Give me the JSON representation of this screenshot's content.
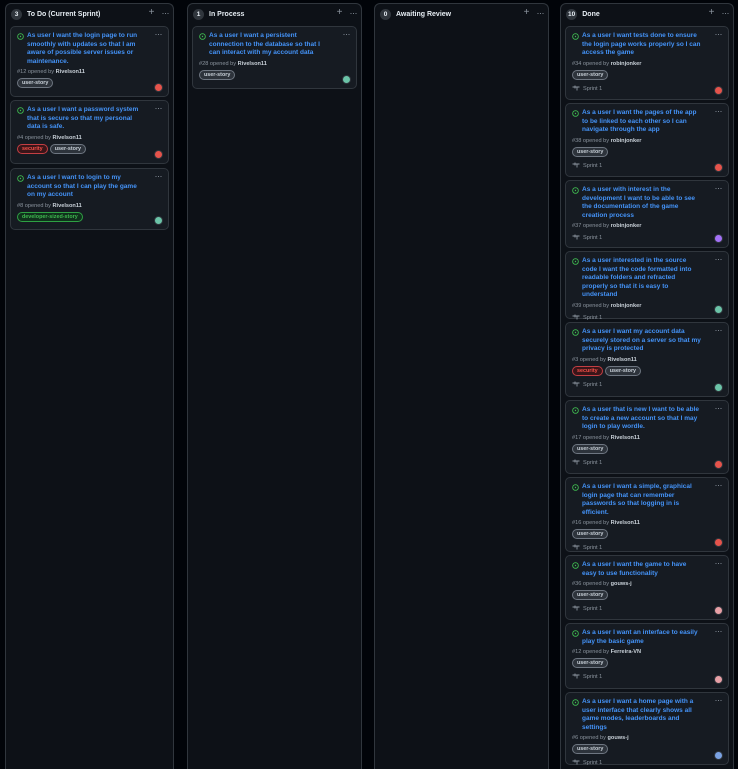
{
  "columns": [
    {
      "count": "3",
      "title": "To Do (Current Sprint)"
    },
    {
      "count": "1",
      "title": "In Process"
    },
    {
      "count": "0",
      "title": "Awaiting Review"
    },
    {
      "count": "10",
      "title": "Done"
    }
  ],
  "todo_cards": [
    {
      "title": "As user I want the login page to run smoothly with updates so that I am aware of possible server issues or maintenance.",
      "number": "#12",
      "opened": "opened by",
      "author": "Rivelson11",
      "labels": [
        "user-story"
      ]
    },
    {
      "title": "As a user I want a password system that is secure so that my personal data is safe.",
      "number": "#4",
      "opened": "opened by",
      "author": "Rivelson11",
      "labels": [
        "security",
        "user-story"
      ]
    },
    {
      "title": "As a user I want to login to my account so that I can play the game on my account",
      "number": "#8",
      "opened": "opened by",
      "author": "Rivelson11",
      "labels": [
        "developer-sized-story"
      ]
    }
  ],
  "inprocess_cards": [
    {
      "title": "As a user I want a persistent connection to the database so that I can interact with my account data",
      "number": "#28",
      "opened": "opened by",
      "author": "Rivelson11",
      "labels": [
        "user-story"
      ]
    }
  ],
  "done_cards": [
    {
      "title": "As a user I want tests done to ensure the login page works properly so I can access the game",
      "number": "#34",
      "opened": "opened by",
      "author": "robinjonker",
      "labels": [
        "user-story"
      ],
      "sprint": "Sprint 1"
    },
    {
      "title": "As a user I want the pages of the app to be linked to each other so I can navigate through the app",
      "number": "#38",
      "opened": "opened by",
      "author": "robinjonker",
      "labels": [
        "user-story"
      ],
      "sprint": "Sprint 1"
    },
    {
      "title": "As a user with interest in the development I want to be able to see the documentation of the game creation process",
      "number": "#37",
      "opened": "opened by",
      "author": "robinjonker",
      "labels": [],
      "sprint": "Sprint 1"
    },
    {
      "title": "As a user interested in the source code I want the code formatted into readable folders and refracted properly so that it is easy to understand",
      "number": "#39",
      "opened": "opened by",
      "author": "robinjonker",
      "labels": [],
      "sprint": "Sprint 1"
    },
    {
      "title": "As a user I want my account data securely stored on a server so that my privacy is protected",
      "number": "#3",
      "opened": "opened by",
      "author": "Rivelson11",
      "labels": [
        "security",
        "user-story"
      ],
      "sprint": "Sprint 1"
    },
    {
      "title": "As a user that is new I want to be able to create a new account so that I may login to play wordle.",
      "number": "#17",
      "opened": "opened by",
      "author": "Rivelson11",
      "labels": [
        "user-story"
      ],
      "sprint": "Sprint 1"
    },
    {
      "title": "As a user I want a simple, graphical login page that can remember passwords so that logging in is efficient.",
      "number": "#16",
      "opened": "opened by",
      "author": "Rivelson11",
      "labels": [
        "user-story"
      ],
      "sprint": "Sprint 1"
    },
    {
      "title": "As a user I want the game to have easy to use functionality",
      "number": "#36",
      "opened": "opened by",
      "author": "gouws-j",
      "labels": [
        "user-story"
      ],
      "sprint": "Sprint 1"
    },
    {
      "title": "As a user I want an interface to easily play the basic game",
      "number": "#12",
      "opened": "opened by",
      "author": "Ferreira-VN",
      "labels": [
        "user-story"
      ],
      "sprint": "Sprint 1"
    },
    {
      "title": "As a user I want a home page with a user interface that clearly shows all game modes, leaderboards and settings",
      "number": "#6",
      "opened": "opened by",
      "author": "gouws-j",
      "labels": [
        "user-story"
      ],
      "sprint": "Sprint 1"
    }
  ],
  "icons": {
    "open_issue": "issue-opened-icon",
    "sprint": "iteration-icon",
    "add": "plus-icon",
    "menu": "kebab-horizontal-icon"
  },
  "colors": {
    "background": "#010409",
    "column": "#0d1117",
    "card": "#161b22",
    "link": "#4493f8",
    "open": "#3fb950",
    "security": "#f85149"
  }
}
